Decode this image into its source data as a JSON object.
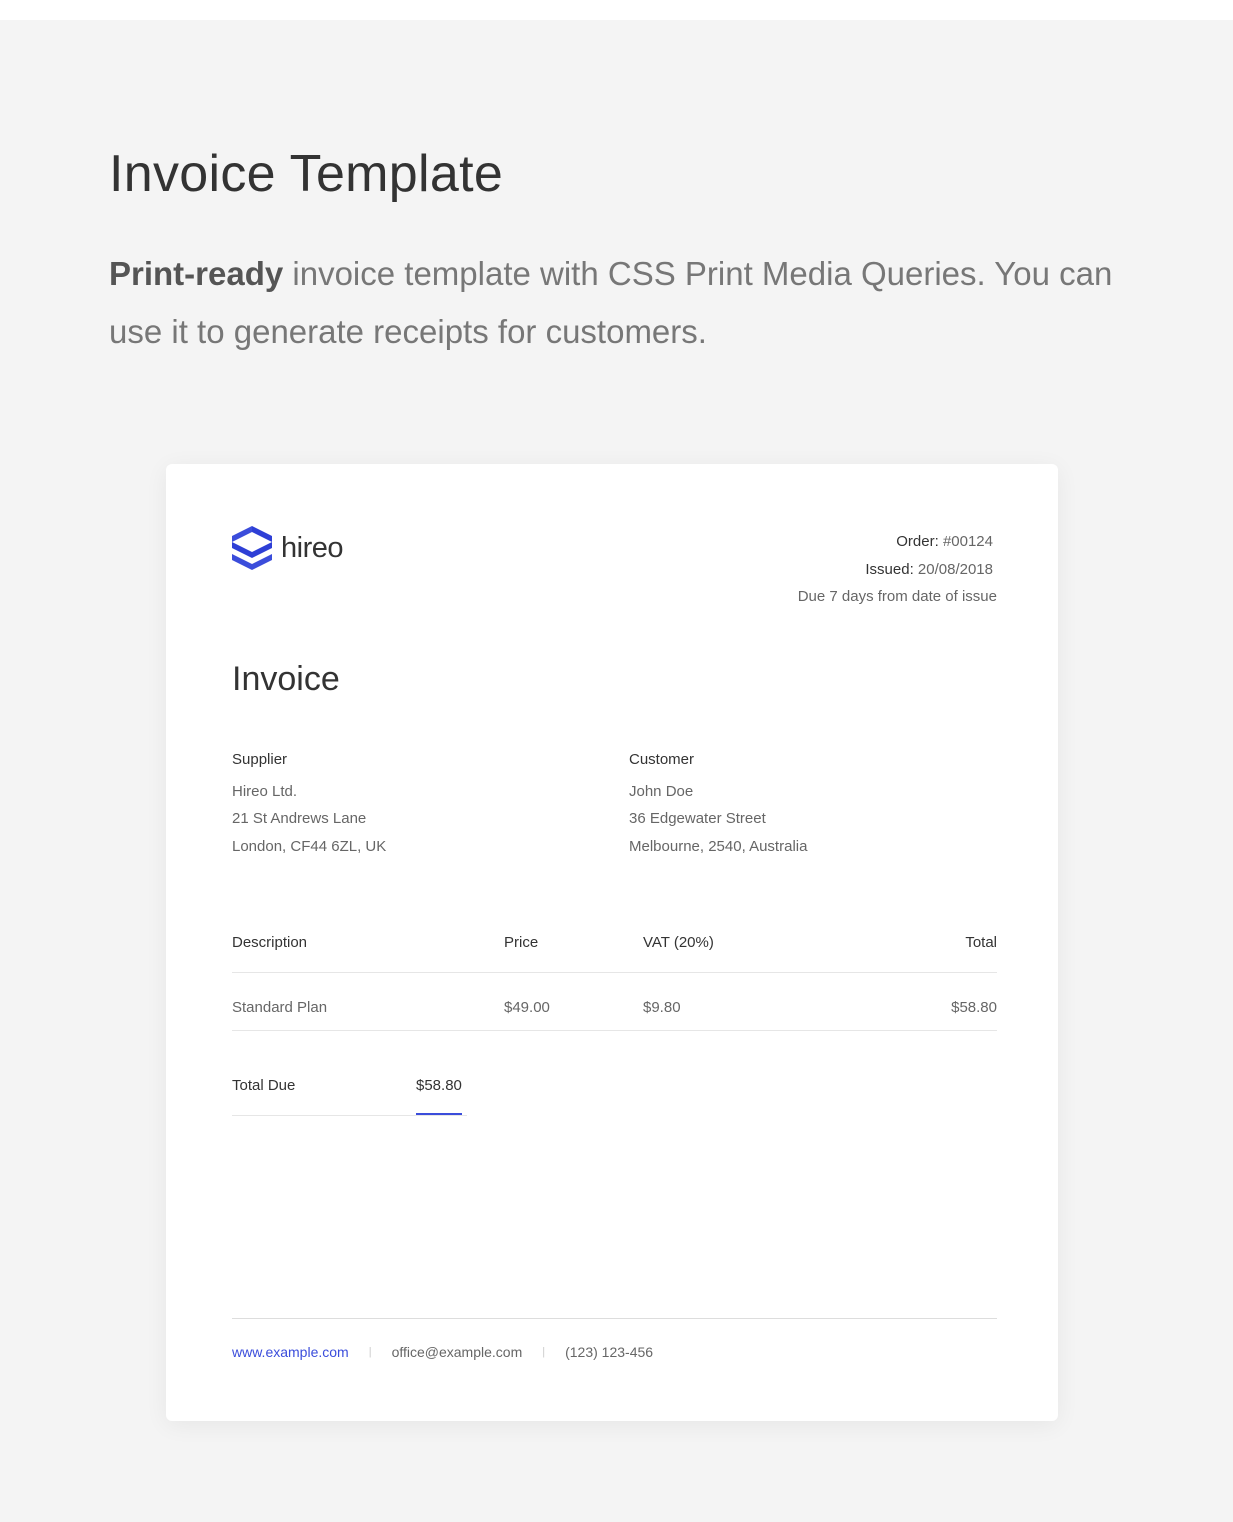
{
  "header": {
    "title": "Invoice Template",
    "intro_bold": "Print-ready",
    "intro_rest": " invoice template with CSS Print Media Queries. You can use it to generate receipts for customers."
  },
  "brand": {
    "name": "hireo",
    "logo_icon": "hireo-logo-icon",
    "accent_color": "#3b4ddb"
  },
  "meta": {
    "order_label": "Order:",
    "order_value": "#00124",
    "issued_label": "Issued:",
    "issued_value": "20/08/2018",
    "due_text": "Due 7 days from date of issue"
  },
  "invoice": {
    "heading": "Invoice"
  },
  "supplier": {
    "title": "Supplier",
    "name": "Hireo Ltd.",
    "street": "21 St Andrews Lane",
    "city": "London, CF44 6ZL, UK"
  },
  "customer": {
    "title": "Customer",
    "name": "John Doe",
    "street": "36 Edgewater Street",
    "city": "Melbourne, 2540, Australia"
  },
  "table": {
    "headers": [
      "Description",
      "Price",
      "VAT (20%)",
      "Total"
    ],
    "rows": [
      [
        "Standard Plan",
        "$49.00",
        "$9.80",
        "$58.80"
      ]
    ]
  },
  "total_due": {
    "label": "Total Due",
    "value": "$58.80"
  },
  "footer": {
    "website": "www.example.com",
    "email": "office@example.com",
    "phone": "(123) 123-456",
    "separator": "|"
  }
}
